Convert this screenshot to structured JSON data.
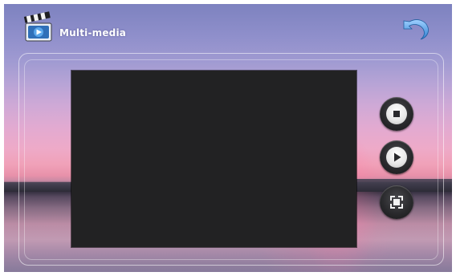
{
  "header": {
    "title": "Multi-media",
    "app_icon": "clapperboard-play-icon",
    "back_icon": "return-arrow-icon"
  },
  "player": {
    "controls": [
      {
        "name": "stop",
        "icon": "stop-icon"
      },
      {
        "name": "play",
        "icon": "play-icon"
      },
      {
        "name": "fullscreen",
        "icon": "fullscreen-icon"
      }
    ]
  },
  "colors": {
    "video_area": "#222223",
    "button_dark": "#2a2a2d",
    "accent_blue": "#3f8fd8"
  }
}
